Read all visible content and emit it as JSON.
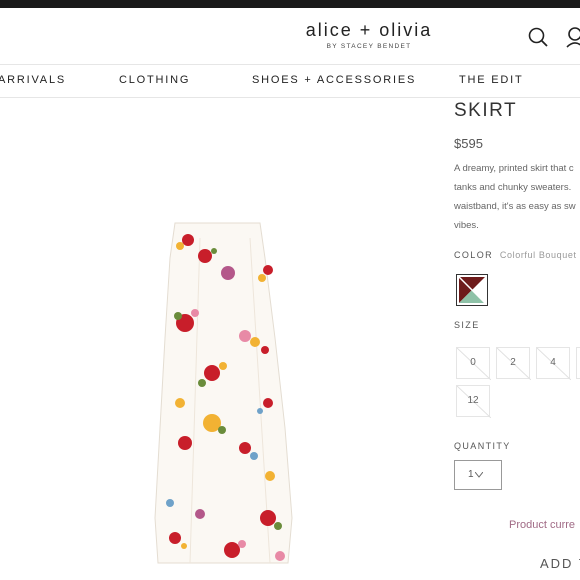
{
  "header": {
    "brand": "alice + olivia",
    "brand_sub": "BY STACEY BENDET",
    "icons": [
      "search-icon",
      "user-icon"
    ]
  },
  "nav": {
    "items": [
      "ARRIVALS",
      "CLOTHING",
      "SHOES + ACCESSORIES",
      "THE EDIT"
    ]
  },
  "product": {
    "title": "SKIRT",
    "price": "$595",
    "description_lines": [
      "A dreamy, printed skirt that c",
      "tanks and chunky sweaters.",
      "waistband, it's as easy as sw",
      "vibes."
    ],
    "color_label": "COLOR",
    "color_value": "Colorful Bouquet",
    "swatch_colors": [
      "#6e1b1b",
      "#8fc2a8",
      "#ffffff"
    ],
    "size_label": "SIZE",
    "sizes": [
      "0",
      "2",
      "4",
      "12"
    ],
    "quantity_label": "QUANTITY",
    "quantity_value": "1",
    "unavailable_text": "Product curre",
    "add_button": "ADD T"
  }
}
